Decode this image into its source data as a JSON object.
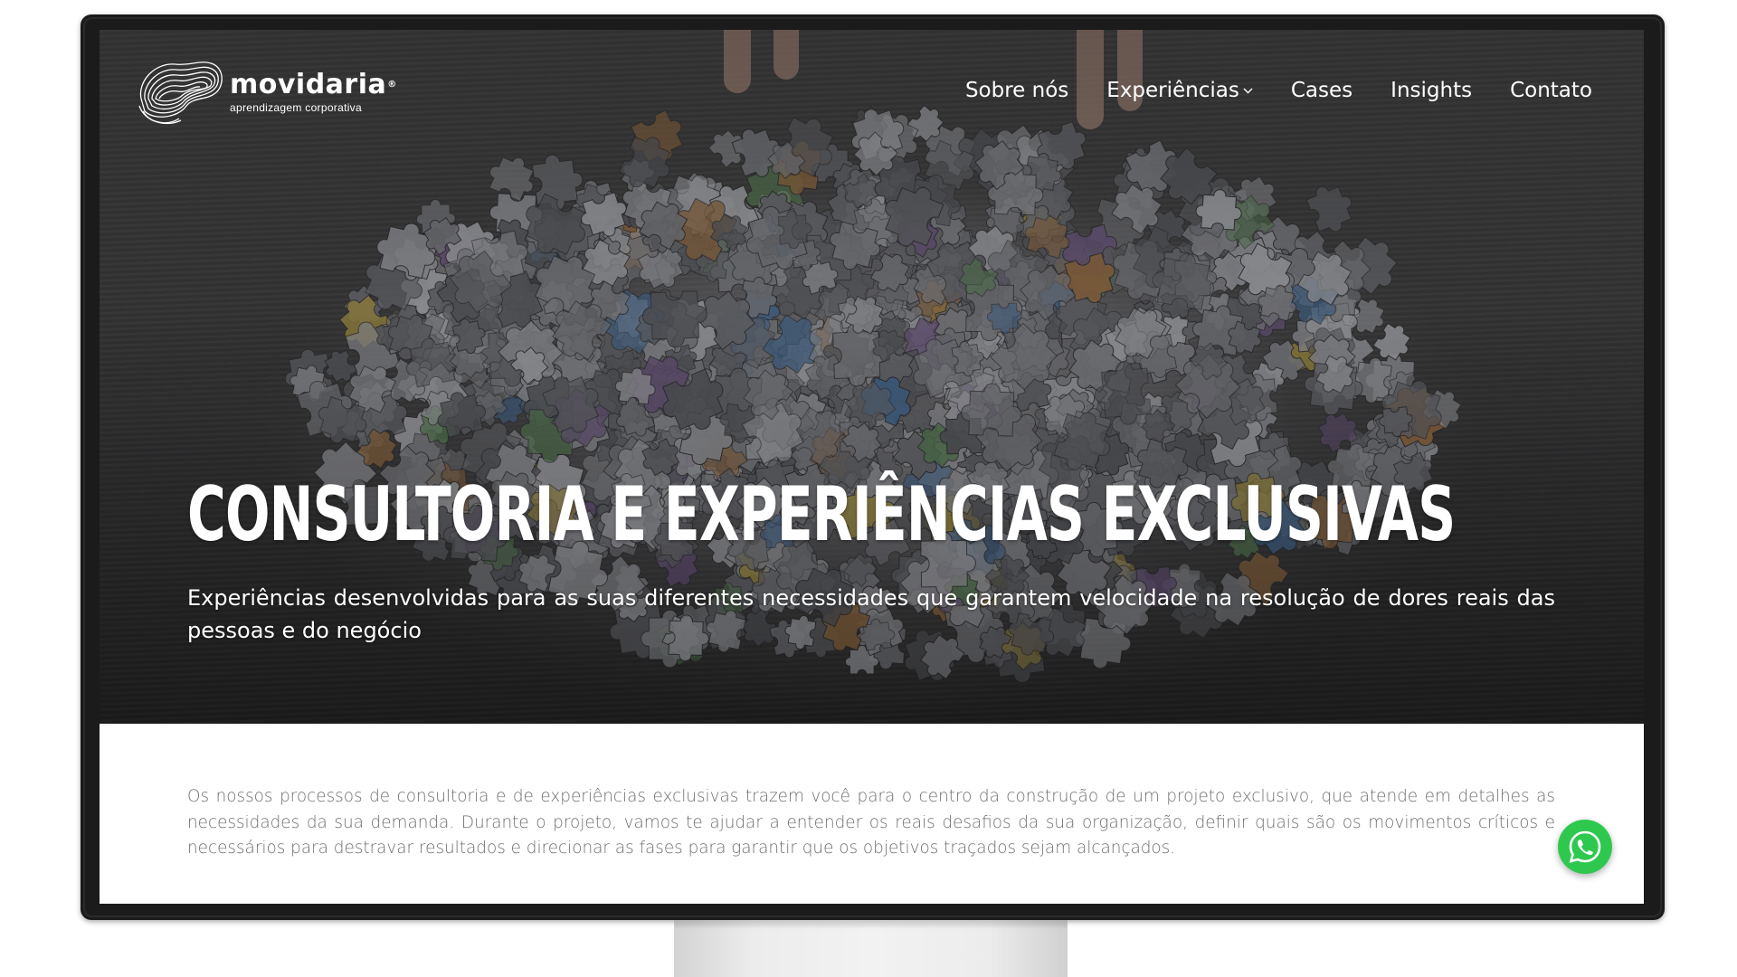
{
  "brand": {
    "name": "movidaria",
    "registered": "®",
    "tagline": "aprendizagem corporativa"
  },
  "nav": {
    "items": [
      {
        "label": "Sobre nós",
        "has_dropdown": false
      },
      {
        "label": "Experiências",
        "has_dropdown": true
      },
      {
        "label": "Cases",
        "has_dropdown": false
      },
      {
        "label": "Insights",
        "has_dropdown": false
      },
      {
        "label": "Contato",
        "has_dropdown": false
      }
    ]
  },
  "hero": {
    "title": "CONSULTORIA E EXPERIÊNCIAS EXCLUSIVAS",
    "subtitle": "Experiências desenvolvidas para as suas diferentes necessidades que garantem velocidade na resolução de dores reais das pessoas e do negócio"
  },
  "content": {
    "paragraph": "Os nossos processos de consultoria e de experiências exclusivas trazem você para o centro da construção de um projeto exclusivo, que atende em detalhes as necessidades da sua demanda. Durante o projeto, vamos te ajudar a entender os reais desafios da sua organização, definir quais são os movimentos críticos e necessários para destravar resultados e direcionar as fases para garantir que os objetivos traçados sejam alcançados."
  },
  "icons": {
    "logo": "wave-contour-logo-icon",
    "dropdown": "chevron-down-icon",
    "chat": "whatsapp-icon"
  },
  "colors": {
    "hero_text": "#ffffff",
    "body_text": "#6f6f6f",
    "whatsapp": "#2fc84f",
    "monitor_bezel": "#1b1b1b"
  }
}
